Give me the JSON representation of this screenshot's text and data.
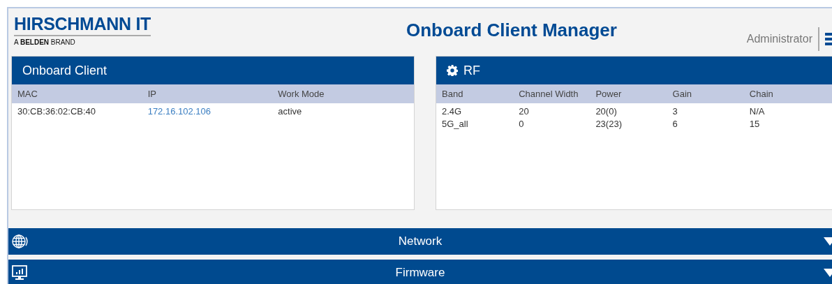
{
  "logo": {
    "name": "HIRSCHMANN IT",
    "tagline_prefix": "A",
    "tagline_brand": "BELDEN",
    "tagline_suffix": "BRAND"
  },
  "title": "Onboard Client Manager",
  "user": "Administrator",
  "panels": [
    {
      "title": "Onboard Client",
      "kind": "plain",
      "columns": [
        "MAC",
        "IP",
        "Work Mode"
      ],
      "rows": [
        {
          "cells": [
            {
              "text": "30:CB:36:02:CB:40",
              "link": false
            },
            {
              "text": "172.16.102.106",
              "link": true
            },
            {
              "text": "active",
              "link": false
            }
          ]
        }
      ]
    },
    {
      "title": "RF",
      "kind": "settings",
      "columns": [
        "Band",
        "Channel Width",
        "Power",
        "Gain",
        "Chain"
      ],
      "rows": [
        {
          "cells": [
            {
              "text": "2.4G",
              "link": false
            },
            {
              "text": "20",
              "link": false
            },
            {
              "text": "20(0)",
              "link": false
            },
            {
              "text": "3",
              "link": false
            },
            {
              "text": "N/A",
              "link": false
            }
          ]
        },
        {
          "cells": [
            {
              "text": "5G_all",
              "link": false
            },
            {
              "text": "0",
              "link": false
            },
            {
              "text": "23(23)",
              "link": false
            },
            {
              "text": "6",
              "link": false
            },
            {
              "text": "15",
              "link": false
            }
          ]
        }
      ]
    }
  ],
  "sections": [
    {
      "label": "Network",
      "kind": "network",
      "expanded": false
    },
    {
      "label": "Firmware",
      "kind": "firmware",
      "expanded": false
    }
  ]
}
